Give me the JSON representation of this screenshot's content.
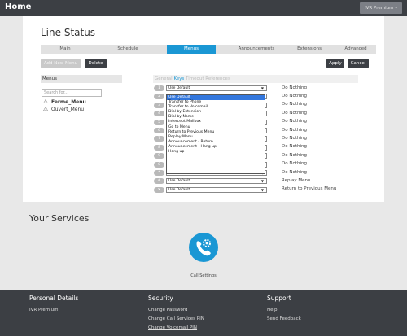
{
  "topbar": {
    "home": "Home",
    "user": "IVR Premium ▾"
  },
  "page_title": "Line Status",
  "tabs": [
    {
      "label": "Main",
      "active": false
    },
    {
      "label": "Schedule",
      "active": false
    },
    {
      "label": "Menus",
      "active": true
    },
    {
      "label": "Announcements",
      "active": false
    },
    {
      "label": "Extensions",
      "active": false
    },
    {
      "label": "Advanced",
      "active": false
    }
  ],
  "buttons": {
    "add": "Add New Menu",
    "delete": "Delete",
    "apply": "Apply",
    "cancel": "Cancel"
  },
  "menus_panel": {
    "header": "Menus",
    "search_placeholder": "Search for...",
    "items": [
      {
        "label": "Ferme_Menu",
        "selected": true,
        "icon": "warning-icon"
      },
      {
        "label": "Ouvert_Menu",
        "selected": false,
        "icon": "warning-icon"
      }
    ]
  },
  "keys_panel": {
    "tabs": [
      {
        "label": "General",
        "active": false
      },
      {
        "label": "Keys",
        "active": true
      },
      {
        "label": "Timeout",
        "active": false
      },
      {
        "label": "References",
        "active": false
      }
    ],
    "rows": [
      {
        "key": "1",
        "value": "Use Default",
        "action": "Do Nothing"
      },
      {
        "key": "2",
        "value": "Use Default",
        "action": "Do Nothing"
      },
      {
        "key": "3",
        "value": "Use Default",
        "action": "Do Nothing"
      },
      {
        "key": "4",
        "value": "Use Default",
        "action": "Do Nothing"
      },
      {
        "key": "5",
        "value": "Use Default",
        "action": "Do Nothing"
      },
      {
        "key": "6",
        "value": "Use Default",
        "action": "Do Nothing"
      },
      {
        "key": "7",
        "value": "Use Default",
        "action": "Do Nothing"
      },
      {
        "key": "8",
        "value": "Use Default",
        "action": "Do Nothing"
      },
      {
        "key": "9",
        "value": "Use Default",
        "action": "Do Nothing"
      },
      {
        "key": "0",
        "value": "Use Default",
        "action": "Do Nothing"
      },
      {
        "key": "*",
        "value": "Use Default",
        "action": "Do Nothing"
      },
      {
        "key": "#",
        "value": "Use Default",
        "action": "Replay Menu"
      },
      {
        "key": "✕",
        "value": "Use Default",
        "action": "Return to Previous Menu"
      }
    ],
    "dropdown_options": [
      "Use Default",
      "Transfer to Phone",
      "Transfer to Voicemail",
      "Dial by Extension",
      "Dial by Name",
      "Intercept Mailbox",
      "Go to Menu",
      "Return to Previous Menu",
      "Replay Menu",
      "Announcement - Return",
      "Announcement - Hang up",
      "Hang up"
    ],
    "dropdown_selected": "Use Default"
  },
  "services": {
    "title": "Your Services",
    "call_settings": "Call Settings"
  },
  "footer": {
    "personal": {
      "title": "Personal Details",
      "items": [
        "IVR Premium"
      ]
    },
    "security": {
      "title": "Security",
      "links": [
        "Change Password",
        "Change Call Services PIN",
        "Change Voicemail PIN"
      ]
    },
    "support": {
      "title": "Support",
      "links": [
        "Help",
        "Send Feedback"
      ]
    }
  },
  "colors": {
    "accent": "#1a97d4",
    "dark": "#3c3f44",
    "dropdown_highlight": "#3377dd"
  }
}
